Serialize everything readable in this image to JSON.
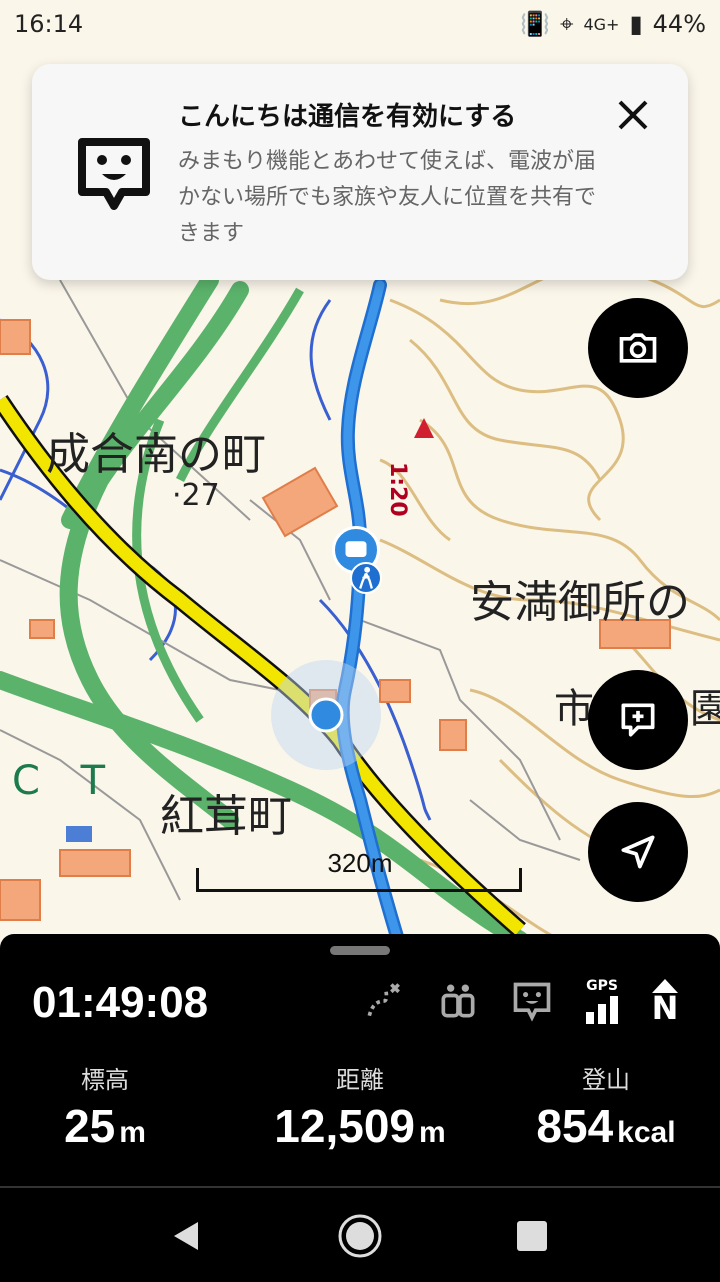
{
  "status_bar": {
    "time": "16:14",
    "network": "4G+",
    "battery": "44%"
  },
  "banner": {
    "title": "こんにちは通信を有効にする",
    "body": "みまもり機能とあわせて使えば、電波が届かない場所でも家族や友人に位置を共有できます"
  },
  "map": {
    "place_labels": [
      "成合南の町",
      "安満御所の",
      "紅茸町",
      "市",
      "園"
    ],
    "elevation_point": "27",
    "route_marker": "1:20",
    "partial_letters": "C T",
    "scale": "320m",
    "colors": {
      "route": "#2f8ae0",
      "highway": "#5bb36b",
      "road_yellow": "#f2e600",
      "contour": "#d6b06b",
      "building": "#f0a070",
      "water": "#3060d0"
    }
  },
  "panel": {
    "elapsed": "01:49:08",
    "stats": [
      {
        "label": "標高",
        "value": "25",
        "unit": "m"
      },
      {
        "label": "距離",
        "value": "12,509",
        "unit": "m"
      },
      {
        "label": "登山",
        "value": "854",
        "unit": "kcal"
      }
    ],
    "gps_label": "GPS",
    "north_label": "N"
  }
}
